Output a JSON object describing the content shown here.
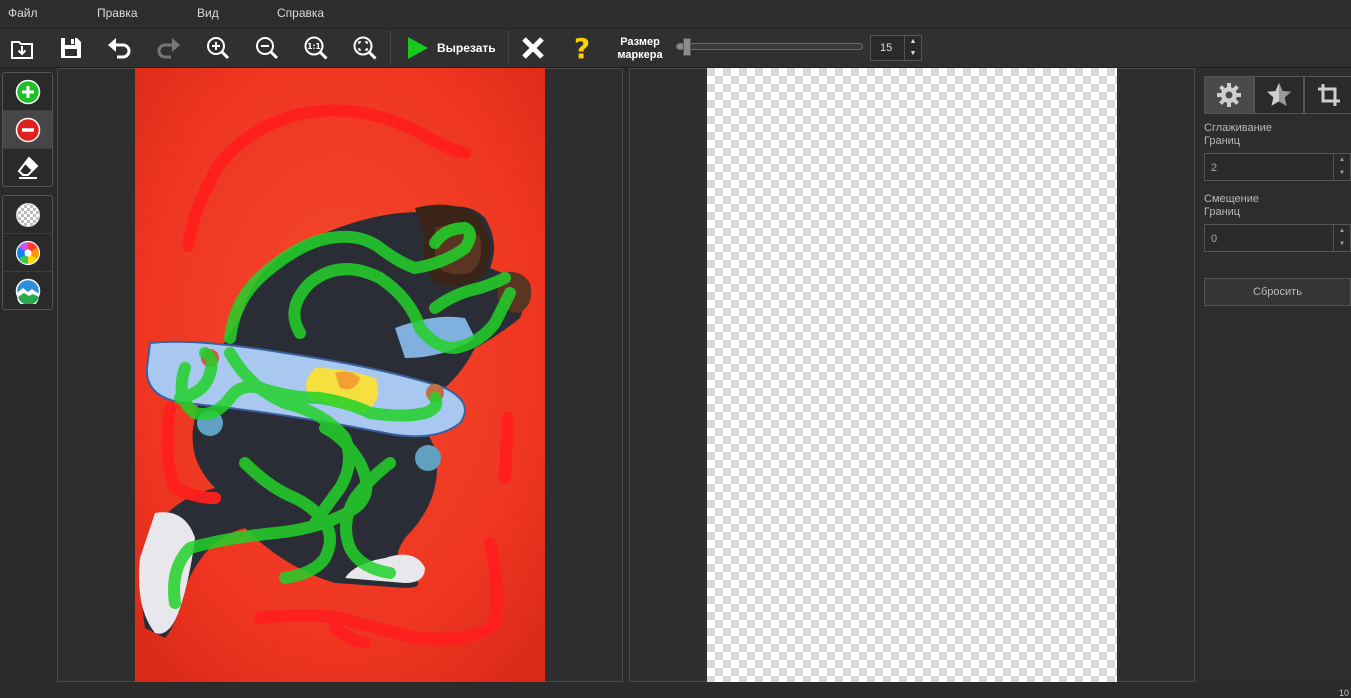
{
  "menu": {
    "file": "Файл",
    "edit": "Правка",
    "view": "Вид",
    "help": "Справка"
  },
  "toolbar": {
    "icons": [
      "import-icon",
      "save-icon",
      "undo-icon",
      "redo-icon",
      "zoom-in-icon",
      "zoom-out-icon",
      "actual-size-icon",
      "fit-icon",
      "play-icon",
      "close-icon",
      "help-icon"
    ],
    "cut_label": "Вырезать",
    "marker_label_line1": "Размер",
    "marker_label_line2": "маркера",
    "marker_slider_fraction": 0.03,
    "marker_size": "15"
  },
  "left_tools": {
    "group1": [
      "add-marker-icon",
      "remove-marker-icon",
      "eraser-icon"
    ],
    "group2": [
      "transparent-bg-icon",
      "color-bg-icon",
      "image-bg-icon"
    ],
    "active": "remove-marker-icon"
  },
  "right_panel": {
    "tabs": [
      "settings-icon",
      "effects-icon",
      "crop-icon"
    ],
    "smoothing_label_line1": "Сглаживание",
    "smoothing_label_line2": "Границ",
    "smoothing_value": "2",
    "offset_label_line1": "Смещение",
    "offset_label_line2": "Границ",
    "offset_value": "0",
    "reset_label": "Сбросить"
  },
  "status": {
    "corner_number": "10"
  },
  "colors": {
    "keep_marker": "#22d22a",
    "remove_marker": "#ff1f1f",
    "photo_bg": "#ee3520",
    "accent_green": "#19c71f",
    "help_yellow": "#ffd000"
  }
}
